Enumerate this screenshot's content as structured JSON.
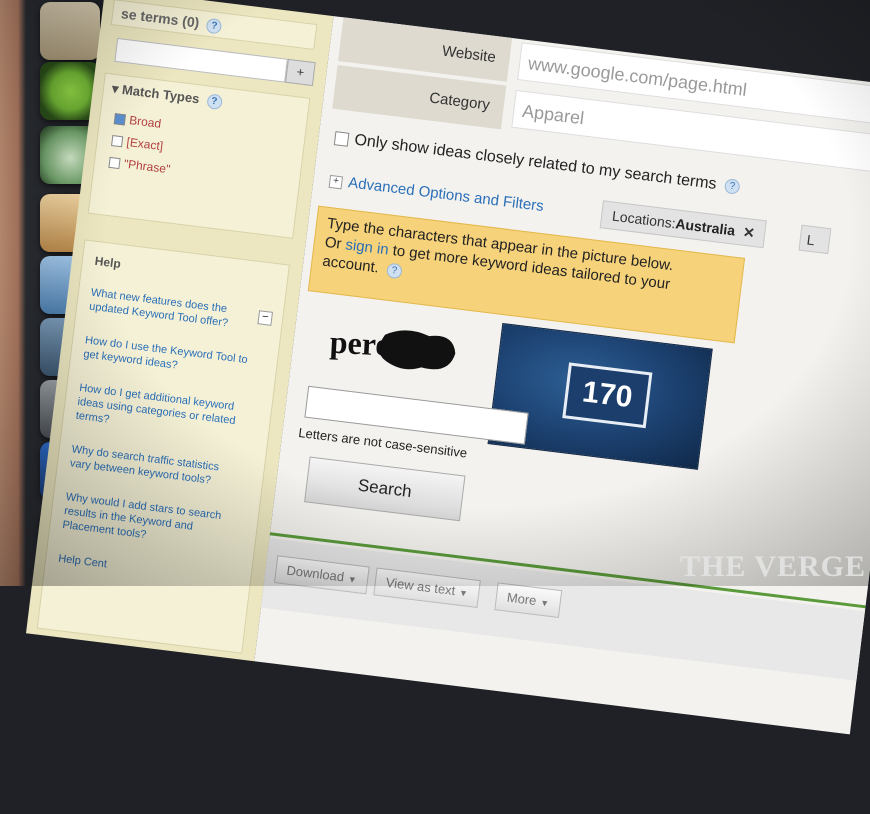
{
  "sidebar": {
    "terms_header": "se terms (0)",
    "add_label": "+",
    "match_types_title": "Match Types",
    "match_options": [
      {
        "label": "Broad",
        "checked": true
      },
      {
        "label": "[Exact]",
        "checked": false
      },
      {
        "label": "\"Phrase\"",
        "checked": false
      }
    ],
    "help_title": "Help",
    "help_minimize": "–",
    "help_links": [
      "What new features does the updated Keyword Tool offer?",
      "How do I use the Keyword Tool to get keyword ideas?",
      "How do I get additional keyword ideas using categories or related terms?",
      "Why do search traffic statistics vary between keyword tools?",
      "Why would I add stars to search results in the Keyword and Placement tools?",
      "Help Cent"
    ]
  },
  "form": {
    "website_label": "Website",
    "website_value": "www.google.com/page.html",
    "category_label": "Category",
    "category_value": "Apparel"
  },
  "only_show_label": "Only show ideas closely related to my search terms",
  "advanced_label": "Advanced Options and Filters",
  "location_chip": {
    "prefix": "Locations:",
    "value": "Australia",
    "close": "✕"
  },
  "location_chip2": "L",
  "warning": {
    "line1": "Type the characters that appear in the picture below.",
    "pre_link": "Or ",
    "link": "sign in",
    "post_link": " to get more keyword ideas tailored to your account."
  },
  "captcha_word": "peroic",
  "captcha_number": "170",
  "case_note": "Letters are not case-sensitive",
  "search_button": "Search",
  "toolbar": {
    "download": "Download",
    "view_as_text": "View as text",
    "more": "More"
  },
  "watermark": "THE VERGE",
  "dock_ps": "Ps",
  "colors": {
    "warning_bg": "#f6d27a",
    "link": "#2a6fb8",
    "accent_green": "#5a9a3a"
  }
}
